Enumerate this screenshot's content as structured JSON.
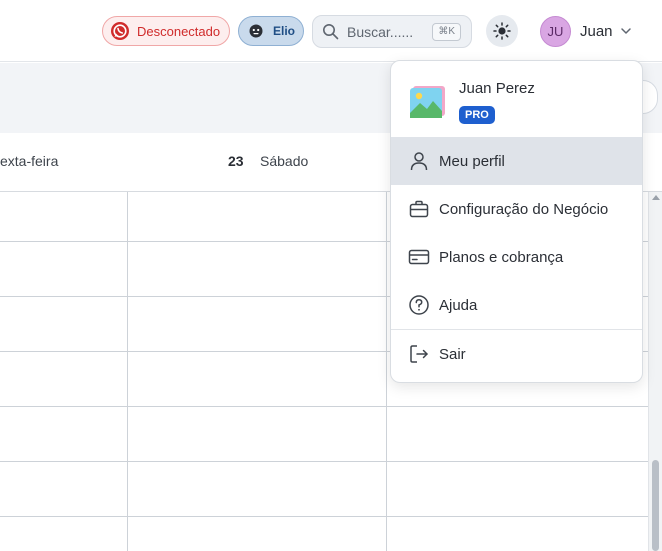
{
  "header": {
    "whatsapp_status": "Desconectado",
    "assistant_name": "Elio",
    "search_placeholder": "Buscar......",
    "search_shortcut": "⌘K",
    "user_initials": "JU",
    "user_name": "Juan"
  },
  "calendar": {
    "day_friday": "exta-feira",
    "day_number": "23",
    "day_saturday": "Sábado"
  },
  "user_menu": {
    "full_name": "Juan Perez",
    "plan_badge": "PRO",
    "items": [
      {
        "label": "Meu perfil",
        "icon": "user-icon",
        "active": true
      },
      {
        "label": "Configuração do Negócio",
        "icon": "briefcase-icon"
      },
      {
        "label": "Planos e cobrança",
        "icon": "credit-card-icon"
      },
      {
        "label": "Ajuda",
        "icon": "help-circle-icon"
      },
      {
        "label": "Sair",
        "icon": "logout-icon"
      }
    ]
  },
  "colors": {
    "status_disconnected": "#d02b2b",
    "assistant_accent": "#1f4e85",
    "pro_badge": "#1e5fcf",
    "active_item_bg": "#dfe3e9"
  }
}
